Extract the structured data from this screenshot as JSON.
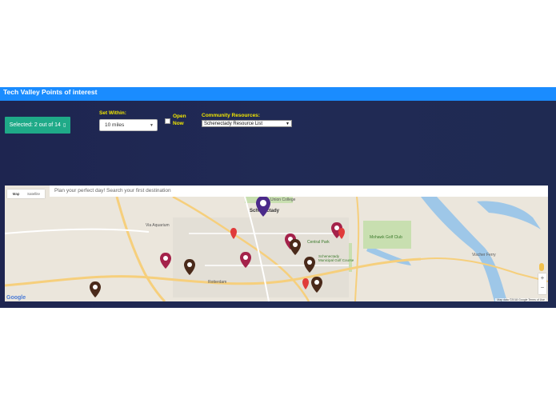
{
  "header": {
    "title": "Tech Valley Points of interest"
  },
  "controls": {
    "selected_label": "Selected: 2 out of 14",
    "set_within_label": "Set Within:",
    "distance_value": "10 miles",
    "open_now_line1": "Open",
    "open_now_line2": "Now",
    "community_label": "Community Resources:",
    "community_value": "Schenectady Resource List"
  },
  "map": {
    "search_placeholder": "Plan your perfect day! Search your first destination",
    "map_type_map": "Map",
    "map_type_satellite": "Satellite",
    "zoom_in": "+",
    "zoom_out": "−",
    "attribution_logo": "Google",
    "attribution_text": "Map data ©2018 Google   Terms of Use",
    "place_labels": {
      "union_college": "Union College",
      "schenectady": "Schenectady",
      "central_park": "Central Park",
      "mohawk_golf": "Mohawk Golf Club",
      "golf_course": "Schenectady Municipal Golf Course",
      "rotterdam": "Rotterdam",
      "vischer_ferry": "Vischer Ferry",
      "aquarium": "Via Aquarium"
    },
    "colors": {
      "pin_maroon": "#a4224a",
      "pin_brown": "#4a2a1a",
      "pin_purple": "#4b2a8a",
      "pin_red": "#e03a3a",
      "water": "#9ec7e8",
      "park": "#c8dfb0",
      "highway": "#f6cf7c"
    }
  }
}
